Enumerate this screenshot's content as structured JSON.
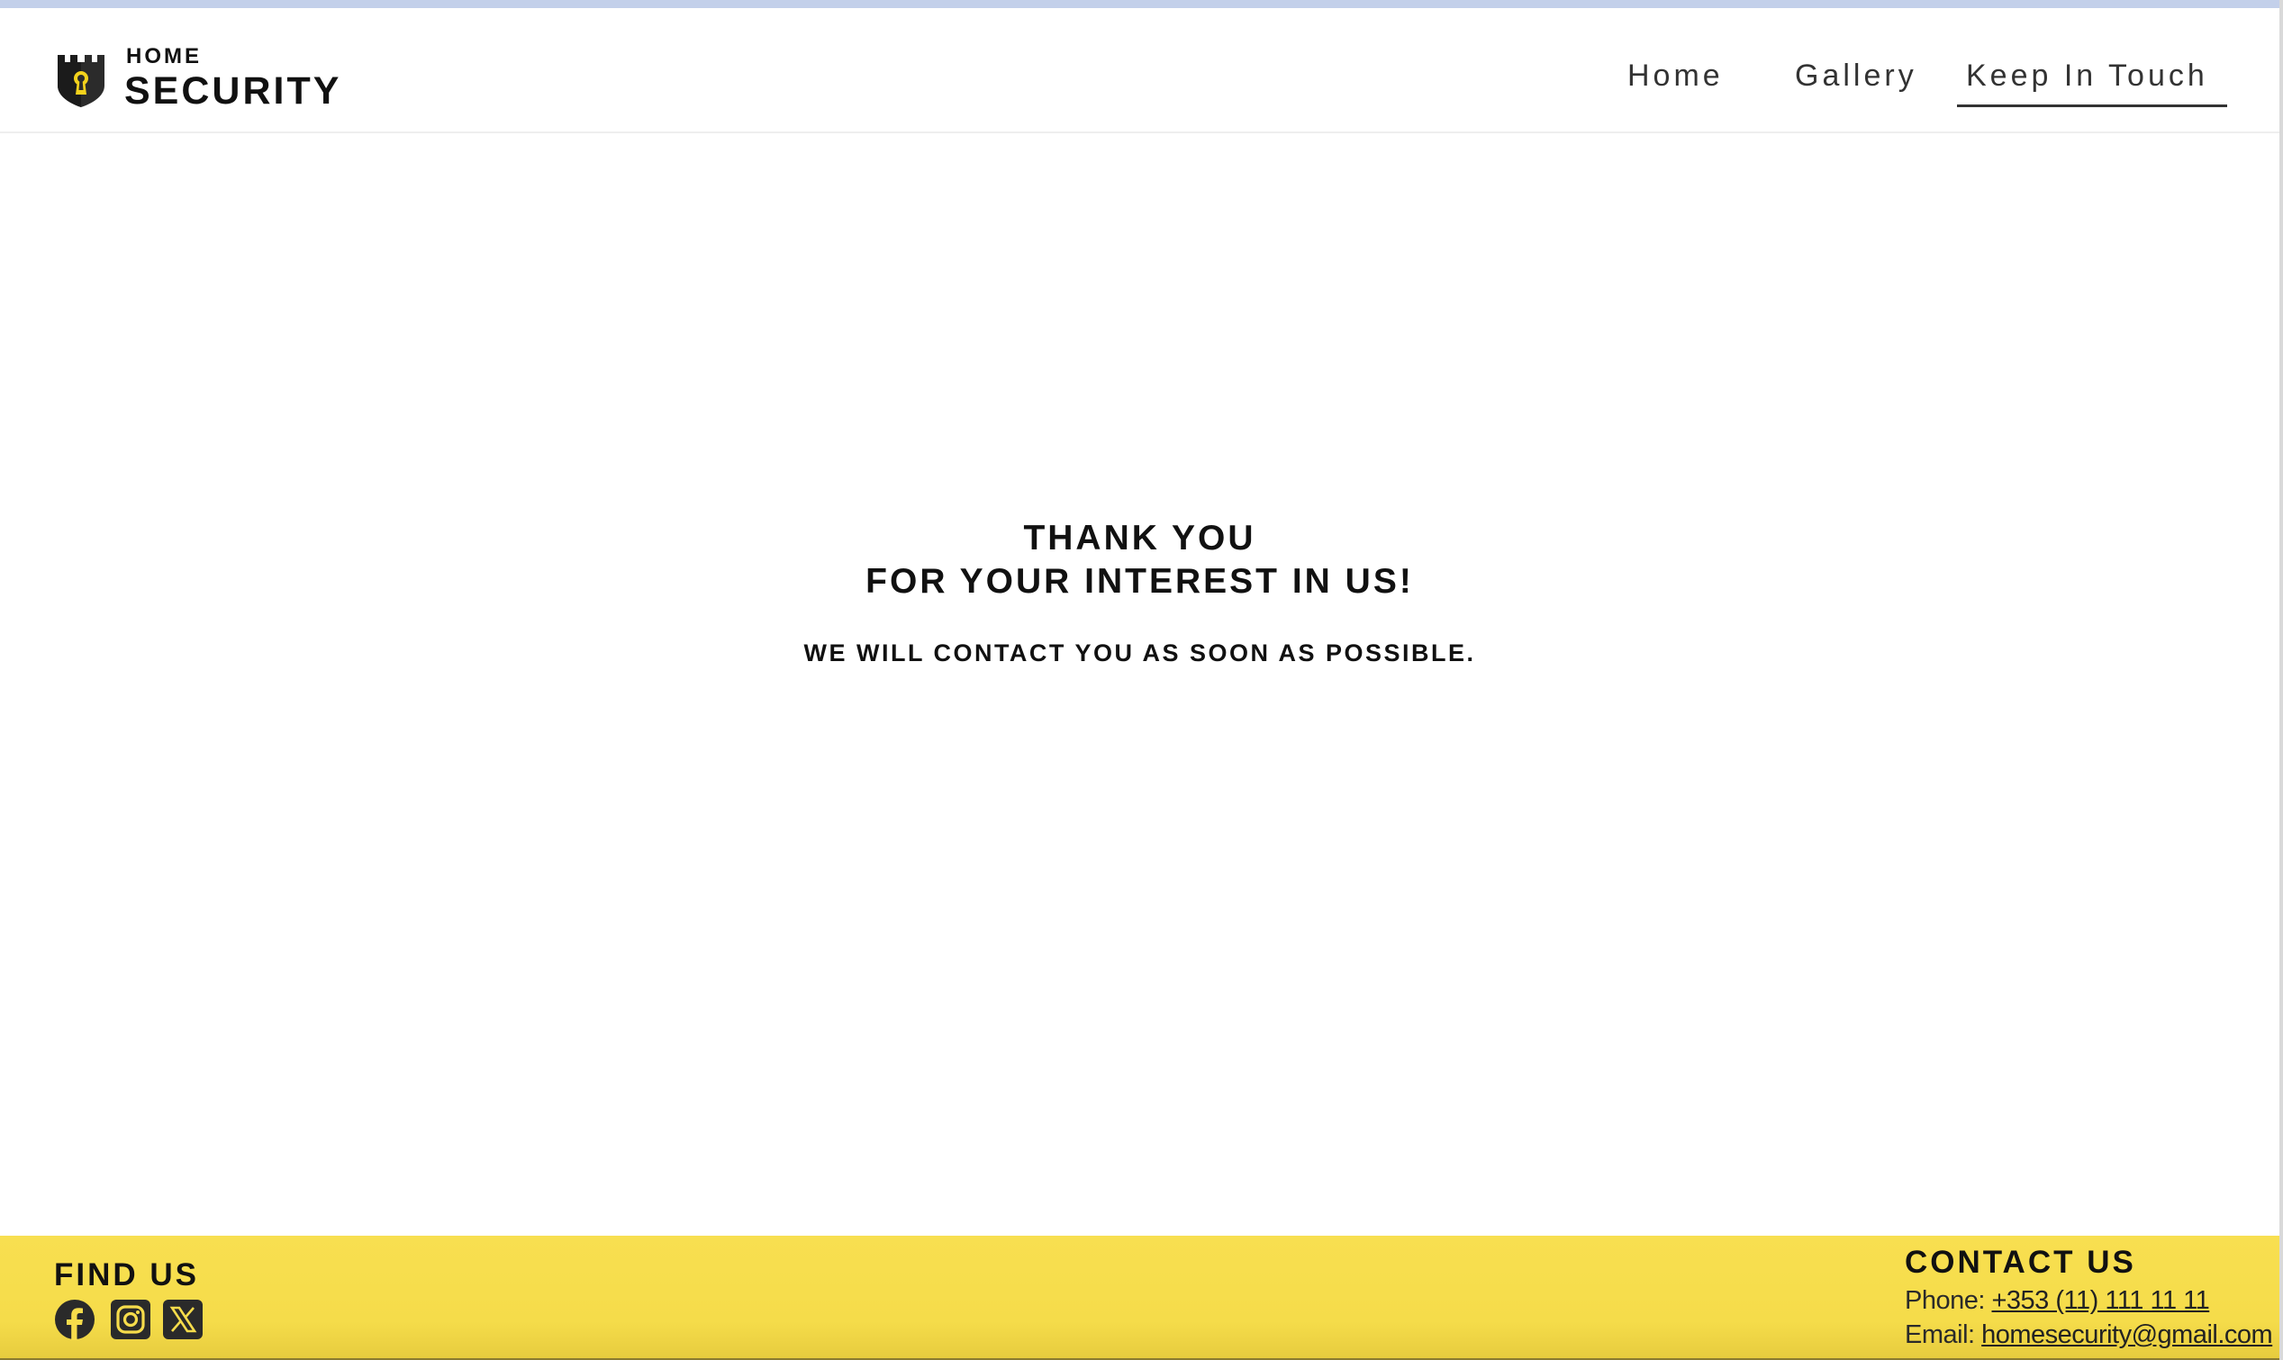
{
  "header": {
    "logo": {
      "line1": "HOME",
      "line2": "SECURITY",
      "icon": "castle-keyhole-icon"
    },
    "nav": [
      {
        "label": "Home",
        "active": false
      },
      {
        "label": "Gallery",
        "active": false
      },
      {
        "label": "Keep In Touch",
        "active": true
      }
    ]
  },
  "main": {
    "title_line1": "THANK YOU",
    "title_line2": "FOR YOUR INTEREST IN US!",
    "message": "WE WILL CONTACT YOU AS SOON AS POSSIBLE."
  },
  "footer": {
    "find_us": {
      "title": "FIND US",
      "social": [
        {
          "name": "facebook-icon"
        },
        {
          "name": "instagram-icon"
        },
        {
          "name": "x-icon"
        }
      ]
    },
    "contact_us": {
      "title": "CONTACT US",
      "phone_label": "Phone: ",
      "phone": "+353 (11) 111 11 11",
      "email_label": "Email: ",
      "email": "homesecurity@gmail.com"
    }
  },
  "colors": {
    "footer_yellow": "#f6dc4b",
    "logo_accent": "#f3d21c",
    "text_dark": "#111111"
  }
}
